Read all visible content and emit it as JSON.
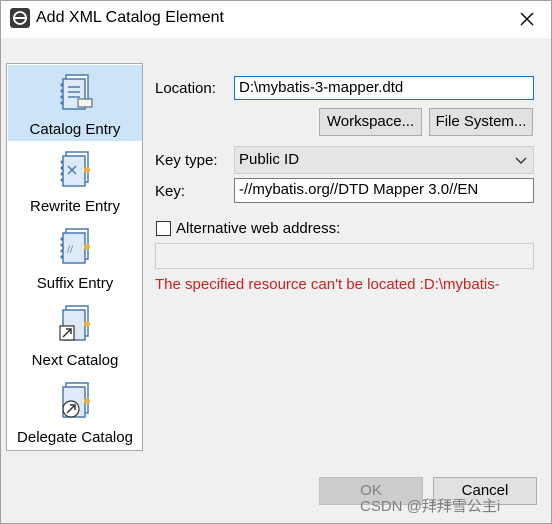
{
  "window": {
    "title": "Add XML Catalog Element"
  },
  "sidebar": {
    "items": [
      {
        "label": "Catalog Entry",
        "selected": true,
        "icon": "catalog-entry-icon"
      },
      {
        "label": "Rewrite Entry",
        "selected": false,
        "icon": "rewrite-entry-icon"
      },
      {
        "label": "Suffix Entry",
        "selected": false,
        "icon": "suffix-entry-icon"
      },
      {
        "label": "Next Catalog",
        "selected": false,
        "icon": "next-catalog-icon"
      },
      {
        "label": "Delegate Catalog",
        "selected": false,
        "icon": "delegate-catalog-icon"
      }
    ]
  },
  "form": {
    "location_label": "Location:",
    "location_value": "D:\\mybatis-3-mapper.dtd",
    "workspace_button": "Workspace...",
    "filesystem_button": "File System...",
    "keytype_label": "Key type:",
    "keytype_value": "Public ID",
    "key_label": "Key:",
    "key_value": "-//mybatis.org//DTD Mapper 3.0//EN",
    "alt_web_label": "Alternative web address:",
    "alt_web_checked": false,
    "alt_web_value": "",
    "error_message": "The specified resource can't be located :D:\\mybatis-"
  },
  "footer": {
    "ok_label": "OK",
    "cancel_label": "Cancel",
    "watermark": "CSDN @拜拜雪公主i"
  },
  "colors": {
    "selection": "#cce4f7",
    "error": "#cc1f1f",
    "focus_border": "#0078d7"
  }
}
